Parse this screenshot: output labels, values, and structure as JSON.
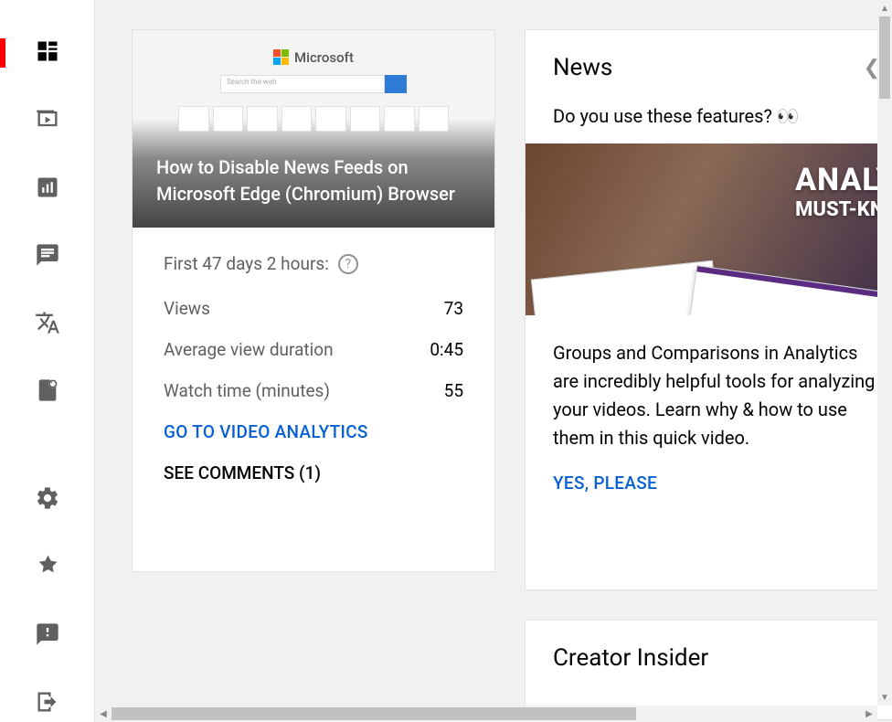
{
  "sidebar": {
    "items": [
      {
        "name": "dashboard"
      },
      {
        "name": "content"
      },
      {
        "name": "analytics"
      },
      {
        "name": "comments"
      },
      {
        "name": "subtitles"
      },
      {
        "name": "copyright"
      },
      {
        "name": "settings"
      },
      {
        "name": "whats-new"
      },
      {
        "name": "send-feedback"
      },
      {
        "name": "creator-studio-classic"
      }
    ]
  },
  "video_card": {
    "thumb_brand": "Microsoft",
    "thumb_search_placeholder": "Search the web",
    "title": "How to Disable News Feeds on Microsoft Edge (Chromium) Browser",
    "period_label": "First 47 days 2 hours:",
    "stats": [
      {
        "label": "Views",
        "value": "73"
      },
      {
        "label": "Average view duration",
        "value": "0:45"
      },
      {
        "label": "Watch time (minutes)",
        "value": "55"
      }
    ],
    "analytics_link": "GO TO VIDEO ANALYTICS",
    "comments_link": "SEE COMMENTS (1)"
  },
  "news_card": {
    "heading": "News",
    "subheading": "Do you use these features? 👀",
    "thumb_line1": "ANALYT",
    "thumb_line2": "MUST-KN",
    "description": "Groups and Comparisons in Analytics are incredibly helpful tools for analyzing your videos. Learn why & how to use them in this quick video.",
    "cta": "YES, PLEASE"
  },
  "insider_card": {
    "heading": "Creator Insider"
  }
}
